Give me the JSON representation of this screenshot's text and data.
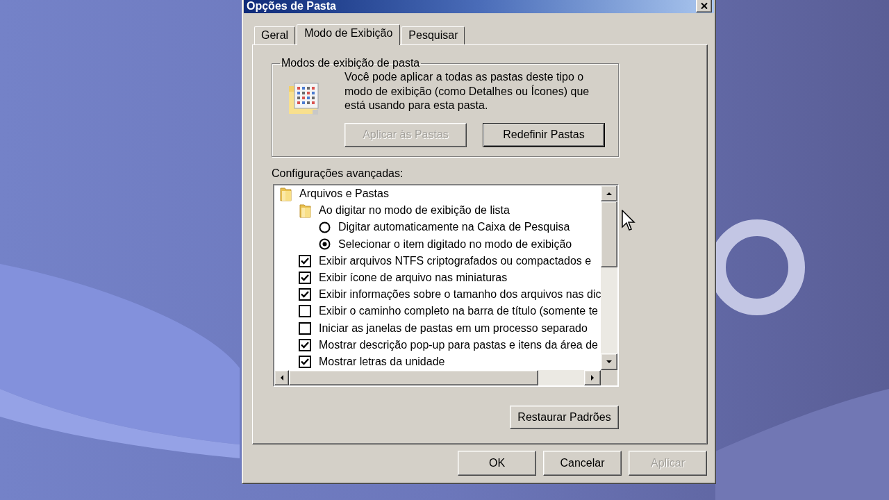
{
  "window": {
    "title": "Opções de Pasta"
  },
  "tabs": [
    {
      "label": "Geral",
      "selected": false
    },
    {
      "label": "Modo de Exibição",
      "selected": true
    },
    {
      "label": "Pesquisar",
      "selected": false
    }
  ],
  "folder_views": {
    "title": "Modos de exibição de pasta",
    "description": "Você pode aplicar a todas as pastas deste tipo o modo de exibição (como Detalhes ou Ícones) que está usando para esta pasta.",
    "buttons": [
      {
        "label": "Aplicar às Pastas",
        "disabled": true,
        "default": false
      },
      {
        "label": "Redefinir Pastas",
        "disabled": false,
        "default": true
      }
    ]
  },
  "advanced_settings": {
    "label": "Configurações avançadas:",
    "items": [
      {
        "kind": "folder",
        "label": "Arquivos e Pastas",
        "children": [
          {
            "kind": "folder",
            "label": "Ao digitar no modo de exibição de lista",
            "children": [
              {
                "kind": "radio",
                "label": "Digitar automaticamente na Caixa de Pesquisa",
                "selected": false
              },
              {
                "kind": "radio",
                "label": "Selecionar o item digitado no modo de exibição",
                "selected": true
              }
            ]
          },
          {
            "kind": "checkbox",
            "label": "Exibir arquivos NTFS criptografados ou compactados e",
            "checked": true
          },
          {
            "kind": "checkbox",
            "label": "Exibir ícone de arquivo nas miniaturas",
            "checked": true
          },
          {
            "kind": "checkbox",
            "label": "Exibir informações sobre o tamanho dos arquivos nas dic",
            "checked": true
          },
          {
            "kind": "checkbox",
            "label": "Exibir o caminho completo na barra de título (somente te",
            "checked": false
          },
          {
            "kind": "checkbox",
            "label": "Iniciar as janelas de pastas em um processo separado",
            "checked": false
          },
          {
            "kind": "checkbox",
            "label": "Mostrar descrição pop-up para pastas e itens da área de",
            "checked": true
          },
          {
            "kind": "checkbox",
            "label": "Mostrar letras da unidade",
            "checked": true
          }
        ]
      }
    ]
  },
  "restore_button": {
    "label": "Restaurar Padrões"
  },
  "buttons": [
    {
      "label": "OK",
      "disabled": false
    },
    {
      "label": "Cancelar",
      "disabled": false
    },
    {
      "label": "Aplicar",
      "disabled": true
    }
  ]
}
